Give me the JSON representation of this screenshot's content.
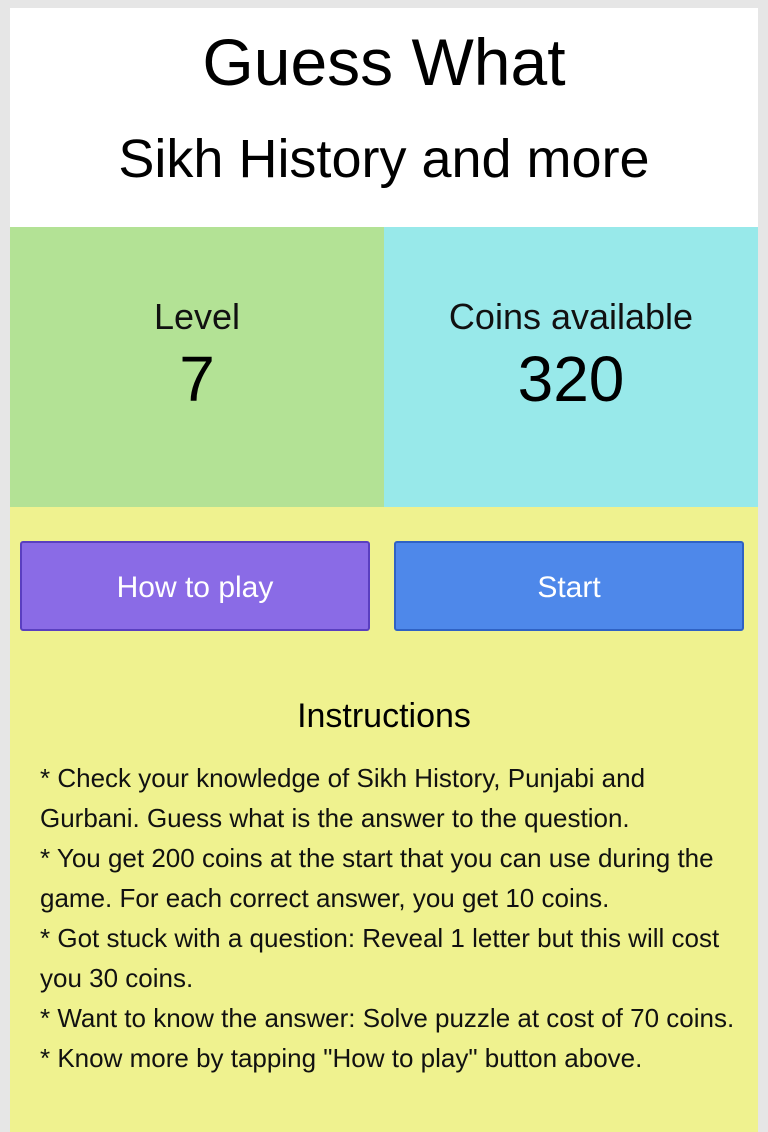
{
  "header": {
    "title": "Guess What",
    "subtitle": "Sikh History and more"
  },
  "stats": {
    "level_label": "Level",
    "level_value": "7",
    "coins_label": "Coins available",
    "coins_value": "320"
  },
  "buttons": {
    "how_to_play": "How to play",
    "start": "Start"
  },
  "instructions": {
    "title": "Instructions",
    "items": [
      "* Check your knowledge of Sikh History, Punjabi and Gurbani. Guess what is the answer to the question.",
      "* You get 200 coins at the start that you can use during the game. For each correct answer, you get 10 coins.",
      "* Got stuck with a question: Reveal 1 letter but this will cost you 30 coins.",
      "* Want to know the answer: Solve puzzle at cost of 70 coins.",
      "* Know more by tapping \"How to play\" button above."
    ]
  },
  "colors": {
    "page_background": "#eff28f",
    "level_panel": "#b3e295",
    "coins_panel": "#98e9ea",
    "how_to_play_button": "#8a6be6",
    "start_button": "#4e88ea"
  }
}
